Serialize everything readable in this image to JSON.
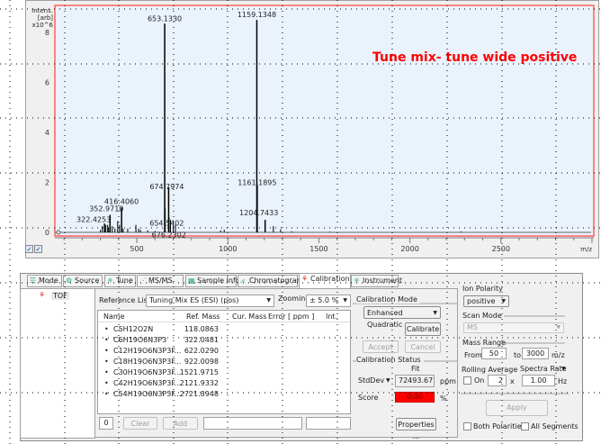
{
  "chart": {
    "y_axis_label": [
      "Intens.",
      "[arb]",
      "x10^6"
    ],
    "x_axis_unit": "m/z",
    "annotation": "Tune mix- tune wide positive",
    "colors": {
      "plot_bg": "#eaf2fc",
      "border": "#ff6060",
      "annotation": "#ff0000",
      "peak": "#000000"
    }
  },
  "chart_data": {
    "type": "bar",
    "title": "",
    "xlabel": "m/z",
    "ylabel": "Intens. [arb] x10^6",
    "xlim": [
      50,
      3010
    ],
    "ylim": [
      0,
      9.1
    ],
    "x_ticks": [
      500,
      1000,
      1500,
      2000,
      2500
    ],
    "y_ticks": [
      0,
      2,
      4,
      6,
      8
    ],
    "peaks": [
      {
        "mz": 322.4253,
        "intensity": 0.35,
        "label": "322.4253"
      },
      {
        "mz": 352.971,
        "intensity": 0.7,
        "label": "352.9710"
      },
      {
        "mz": 416.406,
        "intensity": 1.0,
        "label": "416.4060"
      },
      {
        "mz": 653.133,
        "intensity": 8.35,
        "label": "653.1330"
      },
      {
        "mz": 654.5402,
        "intensity": 0.95,
        "label": "654.5402"
      },
      {
        "mz": 674.7974,
        "intensity": 1.8,
        "label": "674.7974"
      },
      {
        "mz": 676.2302,
        "intensity": 0.6,
        "label": "676.2302"
      },
      {
        "mz": 1159.1348,
        "intensity": 8.5,
        "label": "1159.1348"
      },
      {
        "mz": 1161.1895,
        "intensity": 1.9,
        "label": "1161.1895"
      },
      {
        "mz": 1204.7433,
        "intensity": 0.5,
        "label": "1204.7433"
      }
    ],
    "minor_peaks": [
      [
        300,
        0.1
      ],
      [
        310,
        0.25
      ],
      [
        330,
        0.3
      ],
      [
        340,
        0.3
      ],
      [
        345,
        0.2
      ],
      [
        365,
        0.25
      ],
      [
        380,
        0.15
      ],
      [
        395,
        0.45
      ],
      [
        405,
        0.3
      ],
      [
        425,
        0.15
      ],
      [
        450,
        0.15
      ],
      [
        495,
        0.3
      ],
      [
        510,
        0.15
      ],
      [
        520,
        0.1
      ],
      [
        560,
        0.08
      ],
      [
        600,
        0.05
      ],
      [
        685,
        0.5
      ],
      [
        700,
        0.4
      ],
      [
        712,
        0.3
      ],
      [
        960,
        0.08
      ],
      [
        980,
        0.1
      ],
      [
        1250,
        0.25
      ],
      [
        1290,
        0.12
      ],
      [
        1350,
        0.04
      ],
      [
        1560,
        0.03
      ],
      [
        2280,
        0.04
      ]
    ]
  },
  "chart_toolbar": {
    "check1": "✓",
    "check2": "✓"
  },
  "tabs": [
    {
      "label": "Mode",
      "icon": "mode-icon"
    },
    {
      "label": "Source",
      "icon": "source-icon"
    },
    {
      "label": "Tune",
      "icon": "tune-icon"
    },
    {
      "label": "MS/MS",
      "icon": "msms-icon"
    },
    {
      "label": "Sample Info",
      "icon": "sample-info-icon"
    },
    {
      "label": "Chromatogram",
      "icon": "chromatogram-icon"
    },
    {
      "label": "Calibration",
      "icon": "calibration-icon"
    },
    {
      "label": "Instrument",
      "icon": "instrument-icon"
    }
  ],
  "tree": {
    "item": "TOF"
  },
  "calibration": {
    "reference_list_label": "Reference List",
    "reference_list_value": "Tuning Mix ES (ESI) (pos)",
    "zooming_label": "Zooming",
    "zooming_value": "± 5.0 %",
    "columns": [
      "Name",
      "Ref. Mass",
      "Cur. Mass",
      "Error [ ppm ]",
      "Int."
    ],
    "rows": [
      {
        "name": "C5H12O2N",
        "ref_mass": "118.0863"
      },
      {
        "name": "C6H19O6N3P3",
        "ref_mass": "322.0481"
      },
      {
        "name": "C12H19O6N3P3F...",
        "ref_mass": "622.0290"
      },
      {
        "name": "C18H19O6N3P3F...",
        "ref_mass": "922.0098"
      },
      {
        "name": "C30H19O6N3P3F...",
        "ref_mass": "1521.9715"
      },
      {
        "name": "C42H19O6N3P3F...",
        "ref_mass": "2121.9332"
      },
      {
        "name": "C54H19O6N3P3F...",
        "ref_mass": "2721.8948"
      }
    ],
    "count": "0",
    "clear": "Clear",
    "add": "Add",
    "mode_label": "Calibration Mode",
    "mode_value": "Enhanced Quadratic",
    "calibrate": "Calibrate",
    "accept": "Accept",
    "cancel": "Cancel",
    "status_label": "Calibration Status",
    "fit_label": "Fit",
    "stddev_label": "StdDev",
    "stddev_value": "72493.67",
    "stddev_unit": "ppm",
    "score_label": "Score",
    "score_value": "0.00",
    "score_unit": "%",
    "score_color": "#ff0000",
    "properties": "Properties ..."
  },
  "settings": {
    "ion_polarity_label": "Ion Polarity",
    "ion_polarity_value": "positive",
    "scan_mode_label": "Scan Mode",
    "scan_mode_value": "MS",
    "mass_range_label": "Mass Range",
    "from_label": "From",
    "from_value": "50",
    "to_label": "to",
    "to_value": "3000",
    "mz_unit": "m/z",
    "rolling_label": "Rolling Average",
    "spectra_rate_label": "Spectra Rate",
    "on_label": "On",
    "rolling_value": "2",
    "times": "x",
    "rate_value": "1.00",
    "hz": "Hz",
    "apply": "Apply",
    "both_polarities": "Both Polarities",
    "all_segments": "All Segments"
  }
}
